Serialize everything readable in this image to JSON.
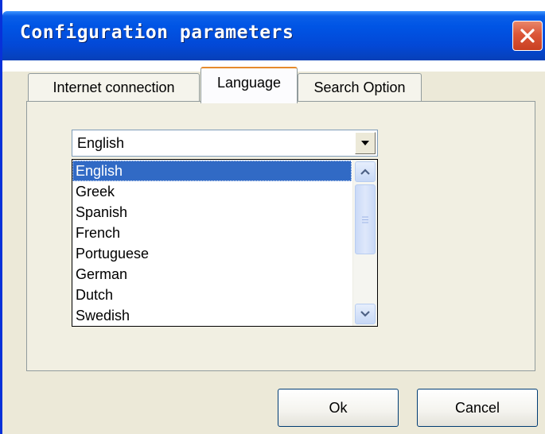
{
  "window": {
    "title": "Configuration parameters"
  },
  "tabs": [
    {
      "label": "Internet connection",
      "active": false
    },
    {
      "label": "Language",
      "active": true
    },
    {
      "label": "Search Option",
      "active": false
    }
  ],
  "language_select": {
    "value": "English",
    "options": [
      "English",
      "Greek",
      "Spanish",
      "French",
      "Portuguese",
      "German",
      "Dutch",
      "Swedish"
    ],
    "highlighted": "English"
  },
  "buttons": {
    "ok_label": "Ok",
    "cancel_label": "Cancel"
  },
  "colors": {
    "titlebar": "#0055E5",
    "selection": "#316AC5",
    "close_button": "#DB5638",
    "active_tab_accent": "#E68B2C"
  },
  "icons": {
    "close": "close-icon",
    "dropdown": "chevron-down-icon",
    "scroll_up": "chevron-up-icon",
    "scroll_down": "chevron-down-icon",
    "scroll_grip": "grip-icon"
  }
}
